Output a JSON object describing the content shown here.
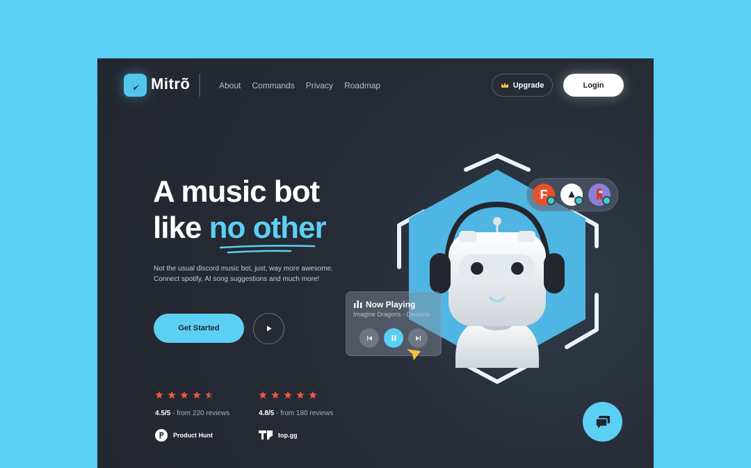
{
  "nav": {
    "logo_text": "Mitrõ",
    "links": [
      "About",
      "Commands",
      "Privacy",
      "Roadmap"
    ],
    "upgrade_label": "Upgrade",
    "login_label": "Login"
  },
  "hero": {
    "title_line1": "A music bot",
    "title_line2_plain": "like ",
    "title_line2_accent": "no other",
    "subtitle_line1": "Not the usual discord music bot, just, way more awesome.",
    "subtitle_line2": "Connect spotify, AI song suggestions and much more!",
    "cta_label": "Get Started"
  },
  "ratings": [
    {
      "score": "4.5/5",
      "text": " - from 220 reviews",
      "stars": 4.5,
      "source": "Product Hunt"
    },
    {
      "score": "4.8/5",
      "text": " - from 180 reviews",
      "stars": 4.8,
      "source": "top.gg"
    }
  ],
  "now_playing": {
    "title": "Now Playing",
    "track": "Imagine Dragons - Demons"
  },
  "colors": {
    "accent": "#5ccff4",
    "background": "#23262f",
    "star": "#f0583e"
  },
  "icons": [
    "logo-icon",
    "crown-icon",
    "play-icon",
    "star-icon",
    "equalizer-icon",
    "prev-icon",
    "pause-icon",
    "next-icon",
    "cursor-icon",
    "chat-icon"
  ]
}
